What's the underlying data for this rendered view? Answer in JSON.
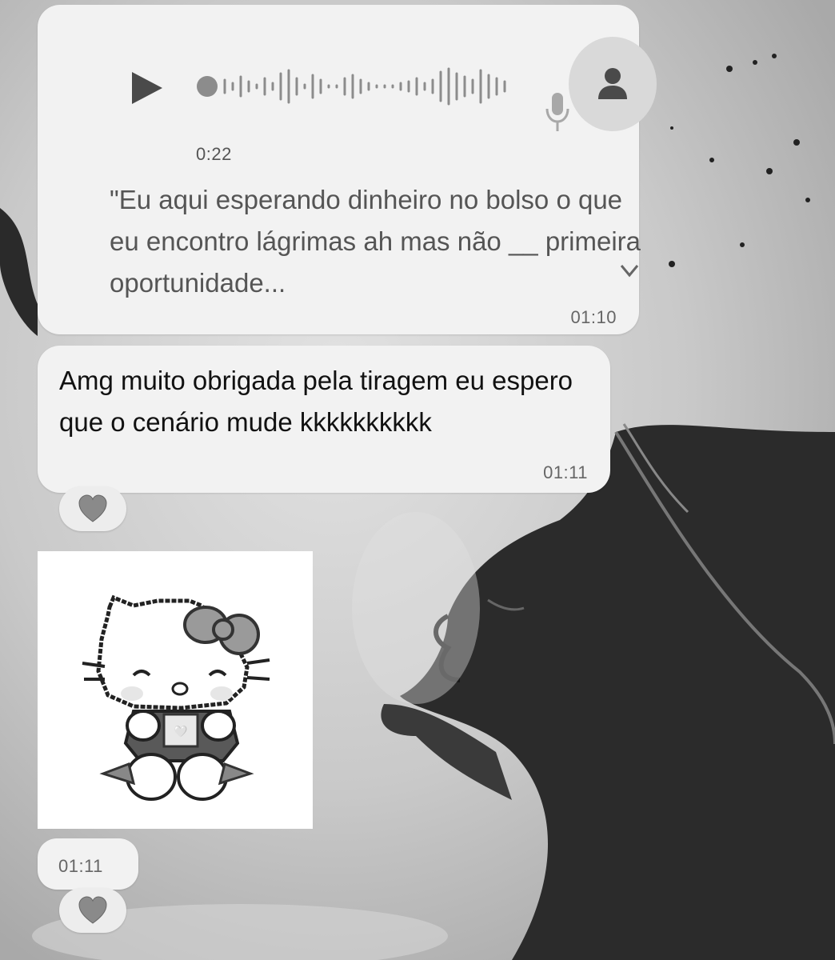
{
  "voice_message": {
    "duration": "0:22",
    "transcript": "\"Eu aqui esperando dinheiro no bolso o que eu encontro lágrimas ah mas não __ primeira oportunidade...",
    "time": "01:10",
    "play_icon": "play-icon",
    "mic_icon": "microphone-icon",
    "avatar_icon": "person-icon",
    "expand_icon": "chevron-down-icon"
  },
  "text_message": {
    "text": "Amg muito obrigada pela tiragem eu espero que o cenário mude kkkkkkkkkk",
    "time": "01:11",
    "reaction": "🩶"
  },
  "sticker_message": {
    "description_icon": "hello-kitty-sticker",
    "time": "01:11",
    "reaction": "🩶"
  },
  "colors": {
    "bubble": "#f2f2f2",
    "background": "#cfcfcf",
    "text": "#111111",
    "muted_text": "#555555"
  }
}
